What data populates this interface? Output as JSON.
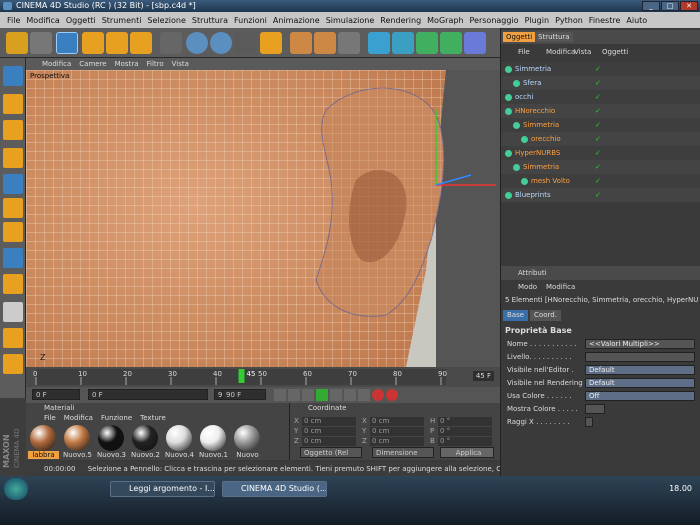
{
  "window": {
    "title": "CINEMA 4D Studio (RC ) (32 Bit) - [sbp.c4d *]"
  },
  "menu": [
    "File",
    "Modifica",
    "Oggetti",
    "Strumenti",
    "Selezione",
    "Struttura",
    "Funzioni",
    "Animazione",
    "Simulazione",
    "Rendering",
    "MoGraph",
    "Personaggio",
    "Plugin",
    "Python",
    "Finestre",
    "Aiuto"
  ],
  "viewport": {
    "menu": [
      "Modifica",
      "Camere",
      "Mostra",
      "Filtro",
      "Vista"
    ],
    "label": "Prospettiva",
    "axis_label": "Z"
  },
  "timeline": {
    "ticks": [
      "0",
      "10",
      "20",
      "30",
      "40",
      "50",
      "60",
      "70",
      "80",
      "90"
    ],
    "current_frame": "45",
    "end_label": "45 F"
  },
  "transport": {
    "field1": "0 F",
    "field2": "0 F",
    "field3": "90 F",
    "field4": "90 F"
  },
  "materials": {
    "title": "Materiali",
    "menu": [
      "File",
      "Modifica",
      "Funzione",
      "Texture"
    ],
    "items": [
      {
        "name": "labbra",
        "color": "#b06a3c"
      },
      {
        "name": "Nuovo.5",
        "color": "#c07a44"
      },
      {
        "name": "Nuovo.3",
        "color": "#111111"
      },
      {
        "name": "Nuovo.2",
        "color": "#222222"
      },
      {
        "name": "Nuovo.4",
        "color": "#dddddd"
      },
      {
        "name": "Nuovo.1",
        "color": "#eeeeee"
      },
      {
        "name": "Nuovo",
        "color": "#999999"
      }
    ]
  },
  "coordinates": {
    "title": "Coordinate",
    "rows": [
      {
        "a": "X",
        "av": "0 cm",
        "b": "X",
        "bv": "0 cm",
        "c": "H",
        "cv": "0 °"
      },
      {
        "a": "Y",
        "av": "0 cm",
        "b": "Y",
        "bv": "0 cm",
        "c": "P",
        "cv": "0 °"
      },
      {
        "a": "Z",
        "av": "0 cm",
        "b": "Z",
        "bv": "0 cm",
        "c": "B",
        "cv": "0 °"
      }
    ],
    "mode": "Oggetto (Rel",
    "dim": "Dimensione",
    "apply": "Applica"
  },
  "status": {
    "time": "00:00:00",
    "text": "Selezione a Pennello: Clicca e trascina per selezionare elementi. Tieni premuto SHIFT per aggiungere alla selezione, CTRL per rim"
  },
  "brand": [
    "MAXON",
    "CINEMA 4D"
  ],
  "objects": {
    "tabs": [
      "Oggetti",
      "Struttura"
    ],
    "menu": [
      "File",
      "Modifica",
      "Vista",
      "Oggetti"
    ],
    "items": [
      {
        "name": "Simmetria",
        "indent": 0,
        "color": "#b8d8ff"
      },
      {
        "name": "Sfera",
        "indent": 1,
        "color": "#b8d8ff"
      },
      {
        "name": "occhi",
        "indent": 0,
        "color": "#b8d8ff"
      },
      {
        "name": "HNorecchio",
        "indent": 0,
        "color": "#ffa040"
      },
      {
        "name": "Simmetria",
        "indent": 1,
        "color": "#ffa040"
      },
      {
        "name": "orecchio",
        "indent": 2,
        "color": "#ffa040"
      },
      {
        "name": "HyperNURBS",
        "indent": 0,
        "color": "#ffa040"
      },
      {
        "name": "Simmetria",
        "indent": 1,
        "color": "#ffa040"
      },
      {
        "name": "mesh Volto",
        "indent": 2,
        "color": "#ffa040"
      },
      {
        "name": "Blueprints",
        "indent": 0,
        "color": "#b8d8ff"
      }
    ]
  },
  "attributes": {
    "title": "Attributi",
    "menu": [
      "Modo",
      "Modifica"
    ],
    "summary": "5 Elementi [HNorecchio, Simmetria, orecchio, HyperNU",
    "tabs": [
      "Base",
      "Coord."
    ],
    "section": "Proprietà Base",
    "rows": [
      {
        "label": "Nome . . . . . . . . . . .",
        "value": "<<Valori Multipli>>"
      },
      {
        "label": "Livello. . . . . . . . . .",
        "value": ""
      },
      {
        "label": "Visibile nell'Editor .",
        "value": "Default"
      },
      {
        "label": "Visibile nel Rendering",
        "value": "Default"
      },
      {
        "label": "Usa Colore . . . . . .",
        "value": "Off"
      },
      {
        "label": "Mostra Colore . . . . .",
        "value": ""
      },
      {
        "label": "Raggi X . . . . . . . .",
        "value": ""
      }
    ]
  },
  "taskbar": {
    "items": [
      "Leggi argomento - I...",
      "CINEMA 4D Studio (..."
    ],
    "clock": "18.00"
  },
  "colors": {
    "skin": "#d49468",
    "wire": "#f5e0cc",
    "accent": "#f0a040"
  }
}
